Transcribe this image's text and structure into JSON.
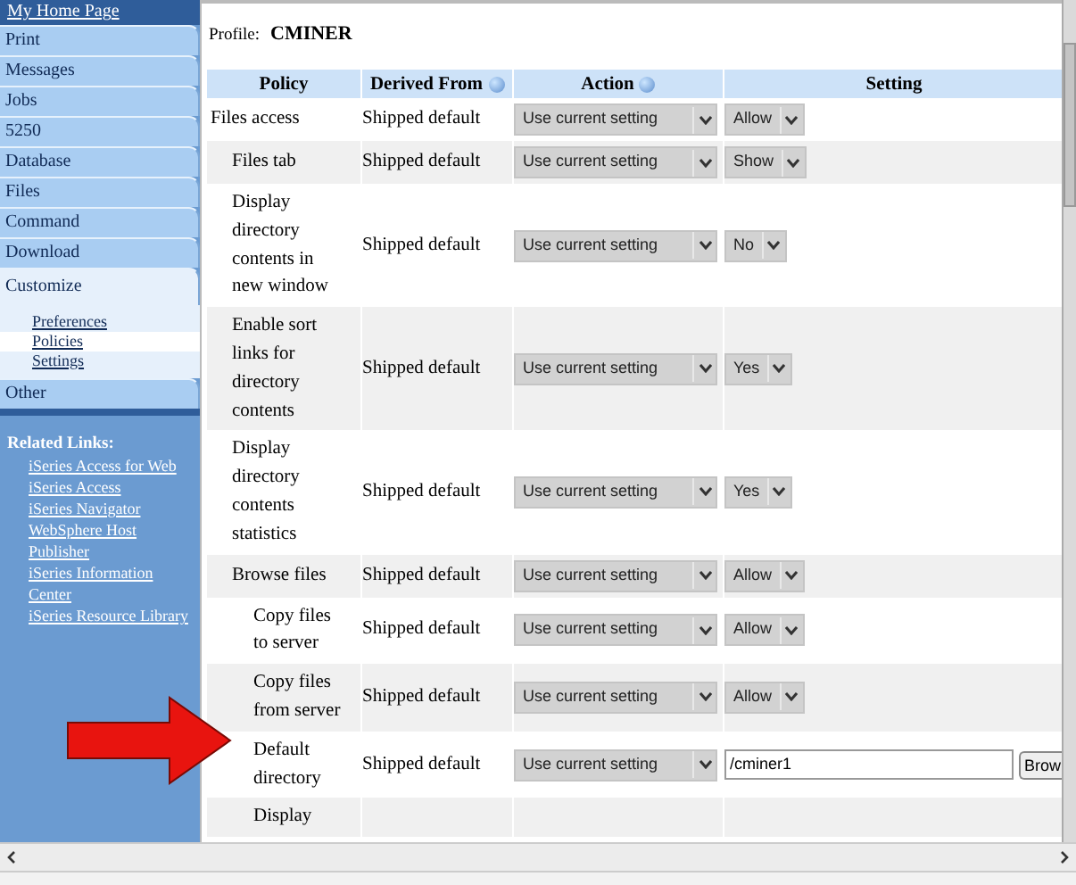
{
  "sidebar": {
    "home_link": "My Home Page",
    "items": [
      {
        "label": "Print",
        "expanded": false
      },
      {
        "label": "Messages",
        "expanded": false
      },
      {
        "label": "Jobs",
        "expanded": false
      },
      {
        "label": "5250",
        "expanded": false
      },
      {
        "label": "Database",
        "expanded": false
      },
      {
        "label": "Files",
        "expanded": false
      },
      {
        "label": "Command",
        "expanded": false
      },
      {
        "label": "Download",
        "expanded": false
      },
      {
        "label": "Customize",
        "expanded": true,
        "children": [
          {
            "label": "Preferences",
            "selected": false
          },
          {
            "label": "Policies",
            "selected": true
          },
          {
            "label": "Settings",
            "selected": false
          }
        ]
      },
      {
        "label": "Other",
        "expanded": false
      }
    ],
    "related_links": {
      "title": "Related Links:",
      "links": [
        "iSeries Access for Web",
        "iSeries Access",
        "iSeries Navigator",
        "WebSphere Host",
        "Publisher",
        "iSeries Information",
        "Center",
        "iSeries Resource Library"
      ]
    }
  },
  "profile": {
    "label": "Profile:",
    "name": "CMINER"
  },
  "table": {
    "columns": [
      {
        "label": "Policy",
        "help": false
      },
      {
        "label": "Derived From",
        "help": true
      },
      {
        "label": "Action",
        "help": true
      },
      {
        "label": "Setting",
        "help": false
      }
    ],
    "rows": [
      {
        "policy": "Files access",
        "derived": "Shipped default",
        "action": "Use current setting",
        "setting": {
          "kind": "select",
          "value": "Allow"
        },
        "children": [
          {
            "policy": "Files tab",
            "derived": "Shipped default",
            "action": "Use current setting",
            "setting": {
              "kind": "select",
              "value": "Show"
            }
          },
          {
            "policy": "Display directory contents in new window",
            "derived": "Shipped default",
            "action": "Use current setting",
            "setting": {
              "kind": "select",
              "value": "No"
            }
          },
          {
            "policy": "Enable sort links for directory contents",
            "derived": "Shipped default",
            "action": "Use current setting",
            "setting": {
              "kind": "select",
              "value": "Yes"
            }
          },
          {
            "policy": "Display directory contents statistics",
            "derived": "Shipped default",
            "action": "Use current setting",
            "setting": {
              "kind": "select",
              "value": "Yes"
            }
          },
          {
            "policy": "Browse files",
            "derived": "Shipped default",
            "action": "Use current setting",
            "setting": {
              "kind": "select",
              "value": "Allow"
            },
            "children": [
              {
                "policy": "Copy files to server",
                "derived": "Shipped default",
                "action": "Use current setting",
                "setting": {
                  "kind": "select",
                  "value": "Allow"
                }
              },
              {
                "policy": "Copy files from server",
                "derived": "Shipped default",
                "action": "Use current setting",
                "setting": {
                  "kind": "select",
                  "value": "Allow"
                }
              },
              {
                "policy": "Default directory",
                "derived": "Shipped default",
                "action": "Use current setting",
                "setting": {
                  "kind": "text",
                  "value": "/cminer1",
                  "button": "Brow"
                }
              },
              {
                "policy": "Display"
              }
            ]
          }
        ]
      }
    ]
  }
}
